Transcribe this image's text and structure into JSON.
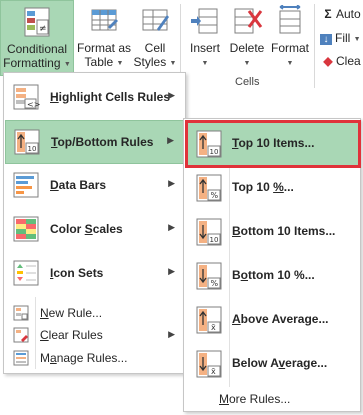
{
  "ribbon": {
    "conditional_formatting": {
      "line1": "Conditional",
      "line2": "Formatting",
      "icon": "conditional-formatting-icon"
    },
    "format_as_table": {
      "line1": "Format as",
      "line2": "Table",
      "icon": "table-grid-icon"
    },
    "cell_styles": {
      "line1": "Cell",
      "line2": "Styles",
      "icon": "cell-styles-icon"
    },
    "insert": {
      "label": "Insert",
      "icon": "insert-cells-icon"
    },
    "delete": {
      "label": "Delete",
      "icon": "delete-cells-icon"
    },
    "format": {
      "label": "Format",
      "icon": "format-cells-icon"
    },
    "cells_group_label": "Cells",
    "autosum": {
      "symbol": "Σ",
      "label": "Auto"
    },
    "fill": {
      "label": "Fill"
    },
    "clear": {
      "label": "Clea"
    }
  },
  "menu": {
    "items": [
      {
        "label": "Highlight Cells Rules",
        "icon": "highlight-cells-icon"
      },
      {
        "label": "Top/Bottom Rules",
        "icon": "top-bottom-rules-icon"
      },
      {
        "label": "Data Bars",
        "icon": "data-bars-icon"
      },
      {
        "label": "Color Scales",
        "icon": "color-scales-icon"
      },
      {
        "label": "Icon Sets",
        "icon": "icon-sets-icon"
      }
    ],
    "new_rule": "New Rule...",
    "clear_rules": "Clear Rules",
    "manage_rules": "Manage Rules..."
  },
  "submenu": {
    "items": [
      {
        "label": "Top 10 Items...",
        "icon": "top-10-items-icon"
      },
      {
        "label": "Top 10 %...",
        "icon": "top-10-percent-icon"
      },
      {
        "label": "Bottom 10 Items...",
        "icon": "bottom-10-items-icon"
      },
      {
        "label": "Bottom 10 %...",
        "icon": "bottom-10-percent-icon"
      },
      {
        "label": "Above Average...",
        "icon": "above-average-icon"
      },
      {
        "label": "Below Average...",
        "icon": "below-average-icon"
      }
    ],
    "more_rules": "More Rules..."
  },
  "colors": {
    "highlight": "#a9d7b5",
    "annotation_border": "#e0323a"
  }
}
